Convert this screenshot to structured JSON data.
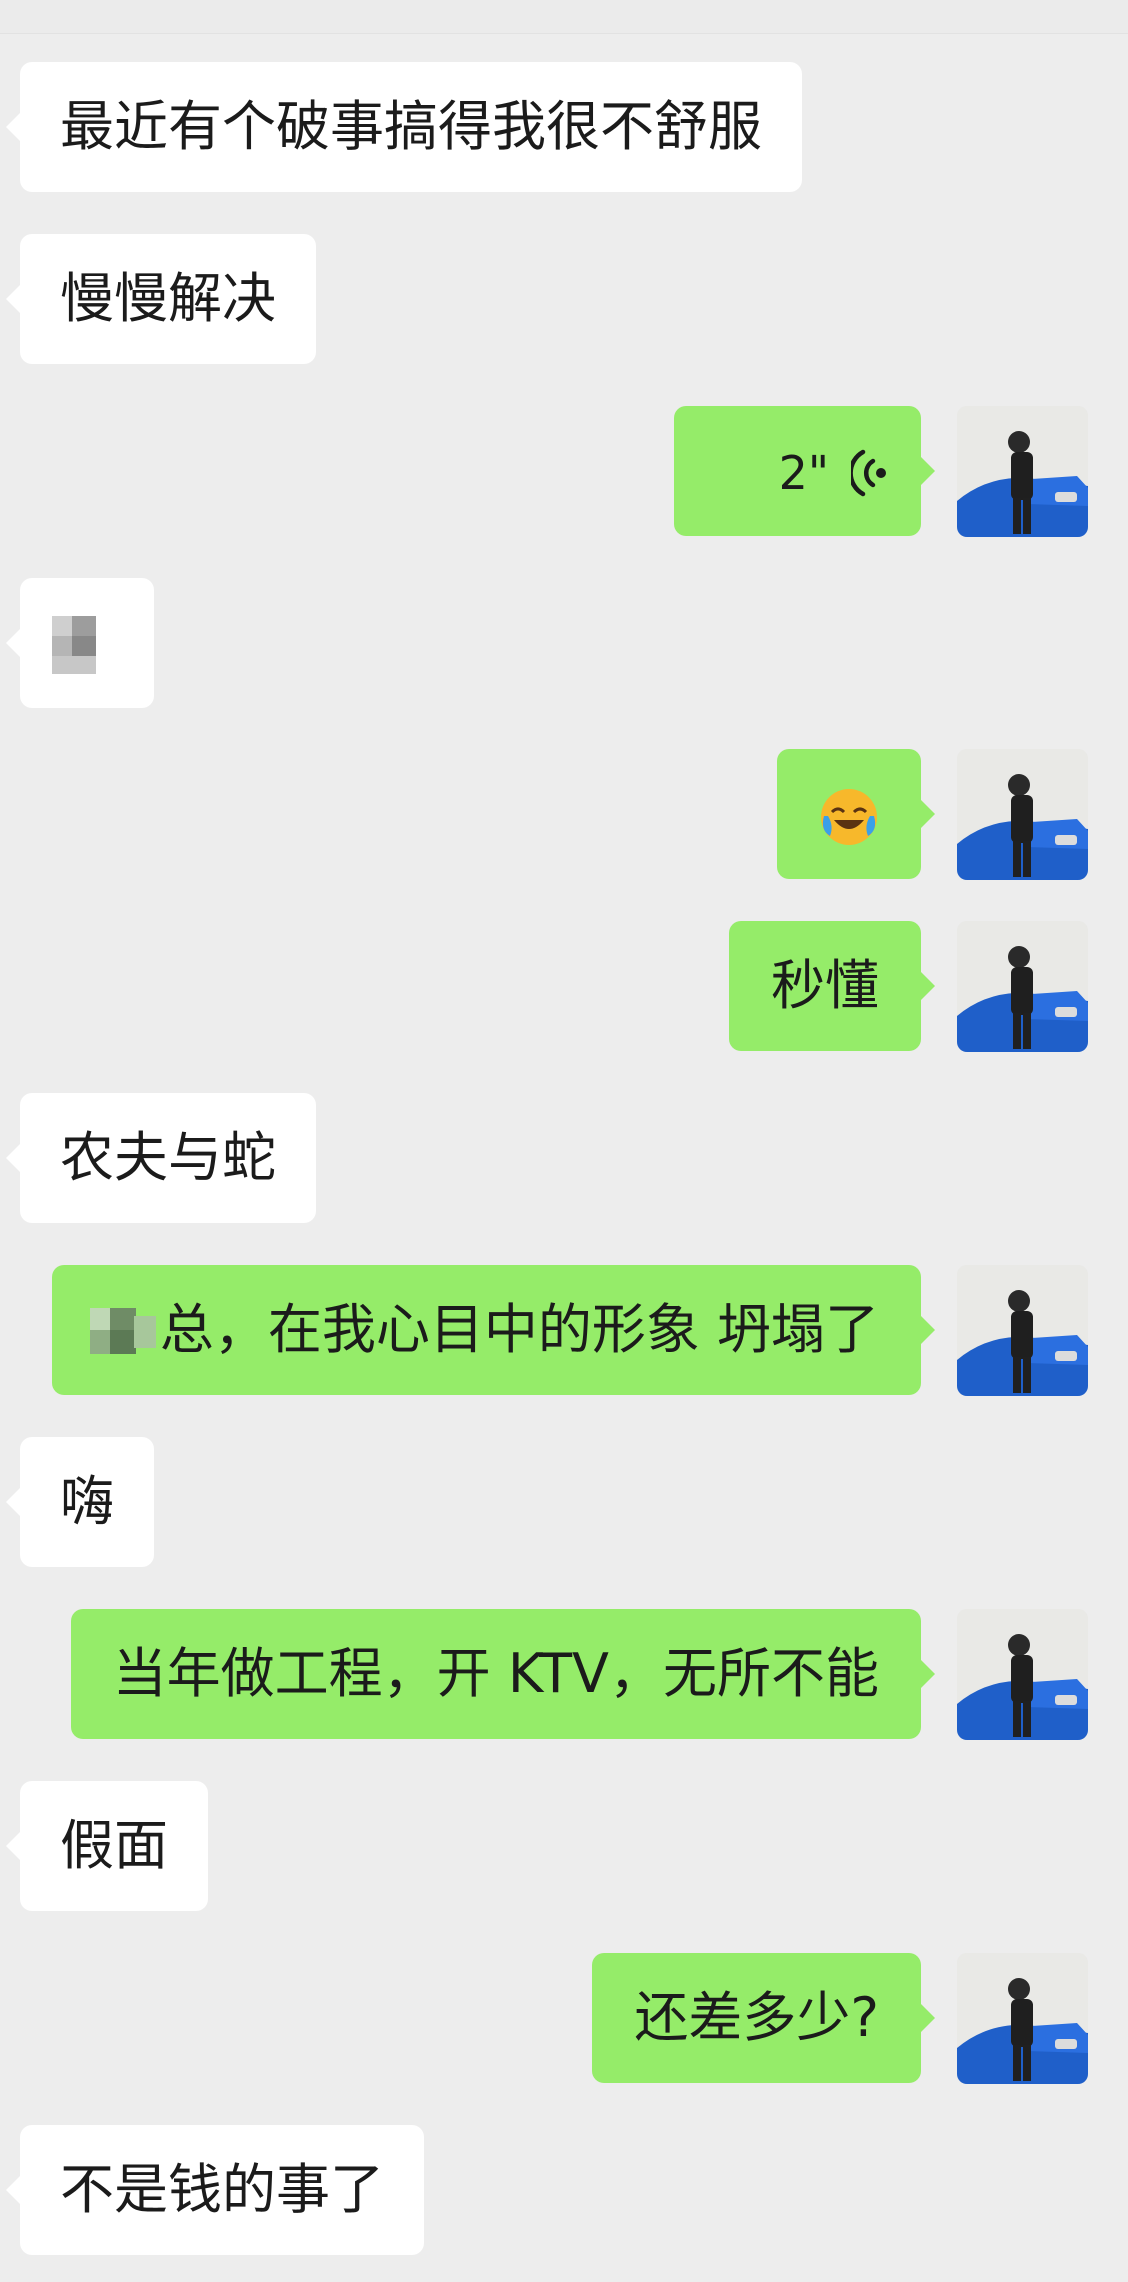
{
  "chat": {
    "messages": [
      {
        "side": "left",
        "type": "text",
        "text": "最近有个破事搞得我很不舒服"
      },
      {
        "side": "left",
        "type": "text",
        "text": "慢慢解决"
      },
      {
        "side": "right",
        "type": "voice",
        "duration": "2\""
      },
      {
        "side": "left",
        "type": "image",
        "text": "blurred-sticker"
      },
      {
        "side": "right",
        "type": "emoji",
        "text": "face-with-tears-of-joy"
      },
      {
        "side": "right",
        "type": "text",
        "text": "秒懂"
      },
      {
        "side": "left",
        "type": "text",
        "text": "农夫与蛇"
      },
      {
        "side": "right",
        "type": "text",
        "text": "总，在我心目中的形象 坍塌了"
      },
      {
        "side": "left",
        "type": "text",
        "text": "嗨"
      },
      {
        "side": "right",
        "type": "text",
        "text": "当年做工程，开 KTV，无所不能"
      },
      {
        "side": "left",
        "type": "text",
        "text": "假面"
      },
      {
        "side": "right",
        "type": "text",
        "text": "还差多少?"
      },
      {
        "side": "left",
        "type": "text",
        "text": "不是钱的事了"
      }
    ]
  },
  "colors": {
    "background": "#ededed",
    "incoming": "#ffffff",
    "outgoing": "#95ec69"
  },
  "icons": {
    "voice": "voice-wave-icon",
    "avatar": "user-avatar"
  }
}
